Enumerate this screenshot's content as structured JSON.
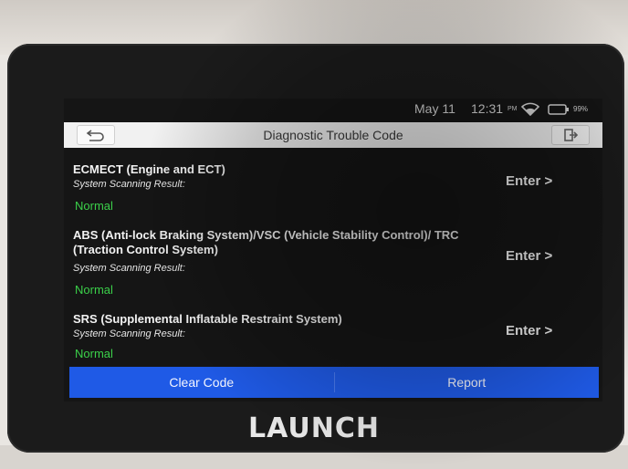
{
  "status": {
    "date": "May 11",
    "time": "12:31",
    "ampm": "PM",
    "battery": "99%"
  },
  "header": {
    "title": "Diagnostic Trouble Code"
  },
  "systems": [
    {
      "name": "ECMECT (Engine and ECT)",
      "result_label": "System Scanning Result:",
      "result_value": "Normal",
      "enter_label": "Enter >"
    },
    {
      "name": "ABS (Anti-lock Braking System)/VSC (Vehicle Stability Control)/ TRC (Traction Control System)",
      "result_label": "System Scanning Result:",
      "result_value": "Normal",
      "enter_label": "Enter >"
    },
    {
      "name": "SRS (Supplemental Inflatable Restraint System)",
      "result_label": "System Scanning Result:",
      "result_value": "Normal",
      "enter_label": "Enter >"
    }
  ],
  "actions": {
    "clear_code": "Clear Code",
    "report": "Report"
  },
  "brand": "LAUNCH",
  "colors": {
    "accent": "#1f5ae6",
    "normal": "#3bd04a"
  }
}
